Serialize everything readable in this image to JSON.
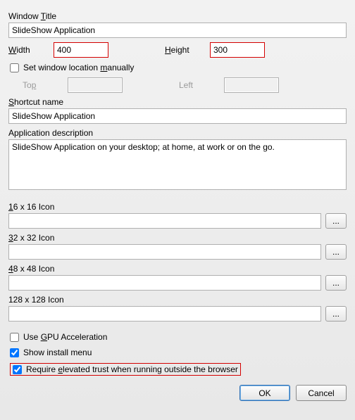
{
  "windowTitle": {
    "label": "Window ",
    "mn": "T",
    "labelAfter": "itle",
    "value": "SlideShow Application"
  },
  "width": {
    "mn": "W",
    "labelAfter": "idth",
    "value": "400"
  },
  "height": {
    "mn": "H",
    "labelAfter": "eight",
    "value": "300"
  },
  "setManual": {
    "label": "Set window location ",
    "mn": "m",
    "labelAfter": "anually",
    "checked": false
  },
  "top": {
    "label": "To",
    "mn": "p",
    "value": ""
  },
  "left": {
    "label": "Left",
    "value": ""
  },
  "shortcut": {
    "mn": "S",
    "labelAfter": "hortcut name",
    "value": "SlideShow Application"
  },
  "description": {
    "label": "Application description",
    "value": "SlideShow Application on your desktop; at home, at work or on the go."
  },
  "icons": {
    "i16": {
      "mn": "1",
      "labelAfter": "6 x 16 Icon",
      "value": ""
    },
    "i32": {
      "mn": "3",
      "labelAfter": "2 x 32 Icon",
      "value": ""
    },
    "i48": {
      "mn": "4",
      "labelAfter": "8 x 48 Icon",
      "value": ""
    },
    "i128": {
      "label": "128 x 128 Icon",
      "value": ""
    },
    "browse": "..."
  },
  "gpu": {
    "label": "Use ",
    "mn": "G",
    "labelAfter": "PU Acceleration",
    "checked": false
  },
  "showMenu": {
    "label": "Show install menu",
    "checked": true
  },
  "elevated": {
    "label": "Require ",
    "mn": "e",
    "labelAfter": "levated trust when running outside the browser",
    "checked": true
  },
  "buttons": {
    "ok": "OK",
    "cancel": "Cancel"
  }
}
